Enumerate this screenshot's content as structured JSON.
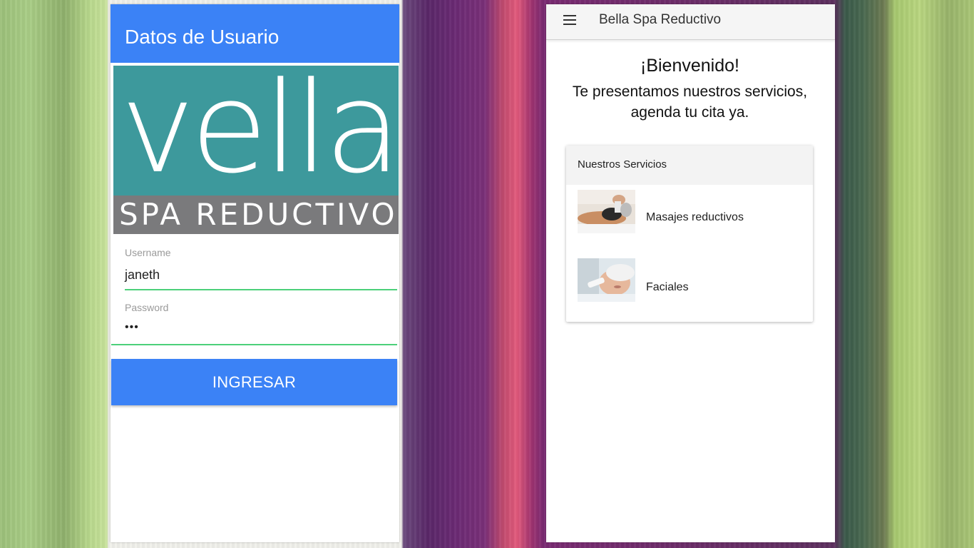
{
  "login": {
    "header_title": "Datos de Usuario",
    "logo_word": "vella",
    "logo_tagline": "SPA REDUCTIVO",
    "username_label": "Username",
    "username_value": "janeth",
    "password_label": "Password",
    "password_value": "•••",
    "submit_label": "INGRESAR"
  },
  "home": {
    "toolbar_title": "Bella Spa Reductivo",
    "welcome": "¡Bienvenido!",
    "intro_line1": "Te presentamos nuestros servicios,",
    "intro_line2": "agenda tu cita ya.",
    "services_header": "Nuestros Servicios",
    "services": [
      {
        "label": "Masajes reductivos",
        "icon": "massage-photo"
      },
      {
        "label": "Faciales",
        "icon": "facial-photo"
      }
    ]
  },
  "colors": {
    "primary_blue": "#3b82f6",
    "logo_teal": "#3d999c",
    "logo_gray": "#7a7a7c",
    "input_focus_green": "#4cd07a"
  }
}
